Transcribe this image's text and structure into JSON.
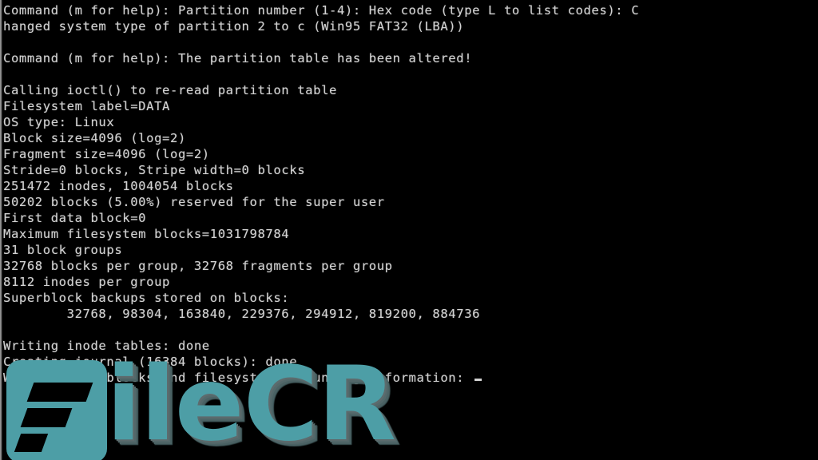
{
  "terminal": {
    "background_color": "#000000",
    "text_color": "#d2d2d2",
    "cursor": "_",
    "lines": [
      "Command (m for help): Partition number (1-4): Hex code (type L to list codes): C",
      "hanged system type of partition 2 to c (Win95 FAT32 (LBA))",
      "",
      "Command (m for help): The partition table has been altered!",
      "",
      "Calling ioctl() to re-read partition table",
      "Filesystem label=DATA",
      "OS type: Linux",
      "Block size=4096 (log=2)",
      "Fragment size=4096 (log=2)",
      "Stride=0 blocks, Stripe width=0 blocks",
      "251472 inodes, 1004054 blocks",
      "50202 blocks (5.00%) reserved for the super user",
      "First data block=0",
      "Maximum filesystem blocks=1031798784",
      "31 block groups",
      "32768 blocks per group, 32768 fragments per group",
      "8112 inodes per group",
      "Superblock backups stored on blocks:",
      "        32768, 98304, 163840, 229376, 294912, 819200, 884736",
      "",
      "Writing inode tables: done",
      "Creating journal (16384 blocks): done",
      "Writing superblocks and filesystem accounting information: "
    ]
  },
  "watermark": {
    "badge_letter": "F",
    "word": "ileCR",
    "brand_color": "#4d9ea6",
    "shadow_color": "#53686a"
  }
}
